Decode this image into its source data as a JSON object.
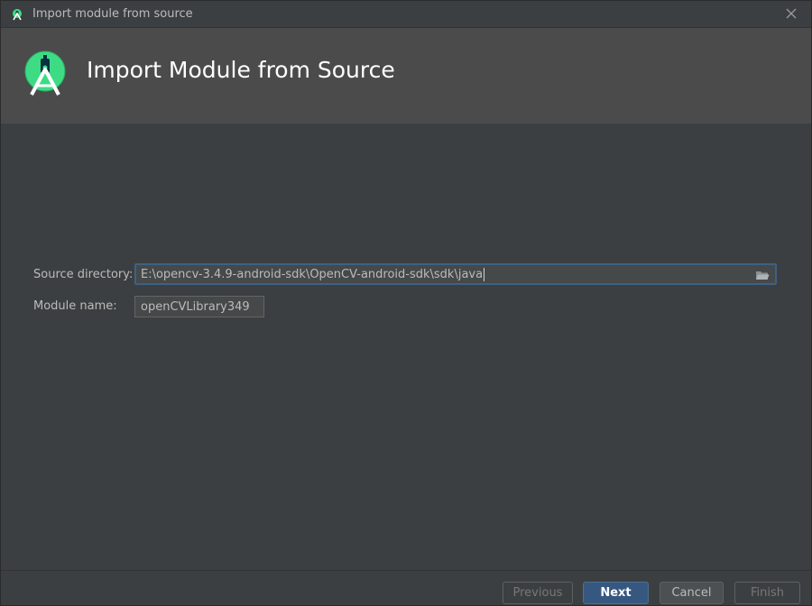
{
  "window": {
    "title": "Import module from source",
    "icon": "android-studio-icon",
    "close_icon": "close-icon"
  },
  "header": {
    "heading": "Import Module from Source",
    "logo": "android-studio-logo"
  },
  "form": {
    "source_directory": {
      "label": "Source directory:",
      "value": "E:\\opencv-3.4.9-android-sdk\\OpenCV-android-sdk\\sdk\\java",
      "browse_icon": "folder-icon"
    },
    "module_name": {
      "label": "Module name:",
      "value": "openCVLibrary349"
    }
  },
  "buttons": {
    "previous": "Previous",
    "next": "Next",
    "cancel": "Cancel",
    "finish": "Finish"
  },
  "colors": {
    "accent": "#3ddc84",
    "primary_button": "#365880",
    "focus_border": "#3d6185"
  }
}
